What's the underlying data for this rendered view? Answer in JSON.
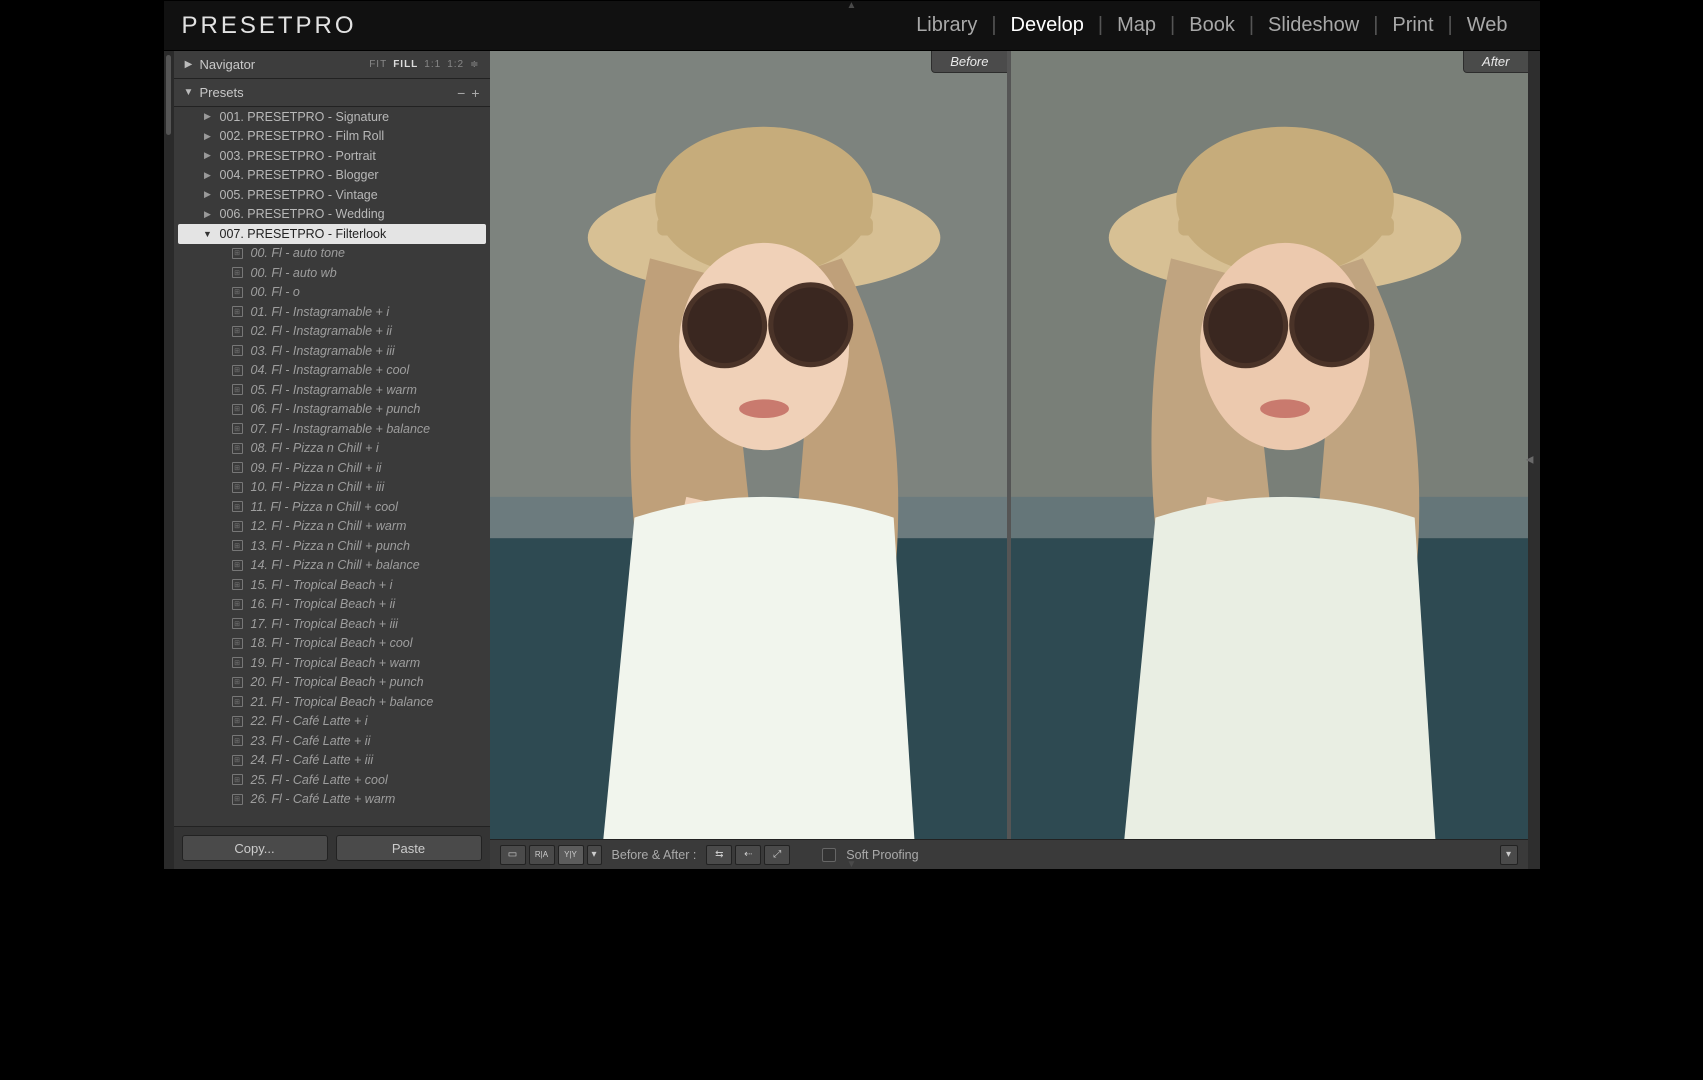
{
  "brand": "PRESETPRO",
  "modules": [
    "Library",
    "Develop",
    "Map",
    "Book",
    "Slideshow",
    "Print",
    "Web"
  ],
  "active_module": "Develop",
  "navigator": {
    "title": "Navigator",
    "zoom_options": [
      "FIT",
      "FILL",
      "1:1",
      "1:2"
    ],
    "zoom_active": "FILL"
  },
  "presets": {
    "title": "Presets",
    "folders": [
      {
        "label": "001. PRESETPRO - Signature",
        "open": false
      },
      {
        "label": "002. PRESETPRO - Film Roll",
        "open": false
      },
      {
        "label": "003. PRESETPRO - Portrait",
        "open": false
      },
      {
        "label": "004. PRESETPRO - Blogger",
        "open": false
      },
      {
        "label": "005. PRESETPRO - Vintage",
        "open": false
      },
      {
        "label": "006. PRESETPRO - Wedding",
        "open": false
      },
      {
        "label": "007. PRESETPRO - Filterlook",
        "open": true,
        "selected": true,
        "items": [
          "00. Fl - auto tone",
          "00. Fl - auto wb",
          "00. Fl - o",
          "01. Fl - Instagramable + i",
          "02. Fl - Instagramable + ii",
          "03. Fl - Instagramable + iii",
          "04. Fl - Instagramable + cool",
          "05. Fl - Instagramable + warm",
          "06. Fl - Instagramable + punch",
          "07. Fl - Instagramable + balance",
          "08. Fl - Pizza n Chill + i",
          "09. Fl - Pizza n Chill + ii",
          "10. Fl - Pizza n Chill + iii",
          "11. Fl - Pizza n Chill + cool",
          "12. Fl - Pizza n Chill + warm",
          "13. Fl - Pizza n Chill + punch",
          "14. Fl - Pizza n Chill + balance",
          "15. Fl - Tropical Beach + i",
          "16. Fl - Tropical Beach + ii",
          "17. Fl - Tropical Beach + iii",
          "18. Fl - Tropical Beach + cool",
          "19. Fl - Tropical Beach + warm",
          "20. Fl - Tropical Beach + punch",
          "21. Fl - Tropical Beach + balance",
          "22. Fl - Café Latte + i",
          "23. Fl - Café Latte + ii",
          "24. Fl - Café Latte + iii",
          "25. Fl - Café Latte + cool",
          "26. Fl - Café Latte + warm"
        ]
      }
    ]
  },
  "buttons": {
    "copy": "Copy...",
    "paste": "Paste"
  },
  "compare": {
    "before": "Before",
    "after": "After"
  },
  "toolbar": {
    "before_after_label": "Before & After :",
    "soft_proofing": "Soft Proofing"
  }
}
